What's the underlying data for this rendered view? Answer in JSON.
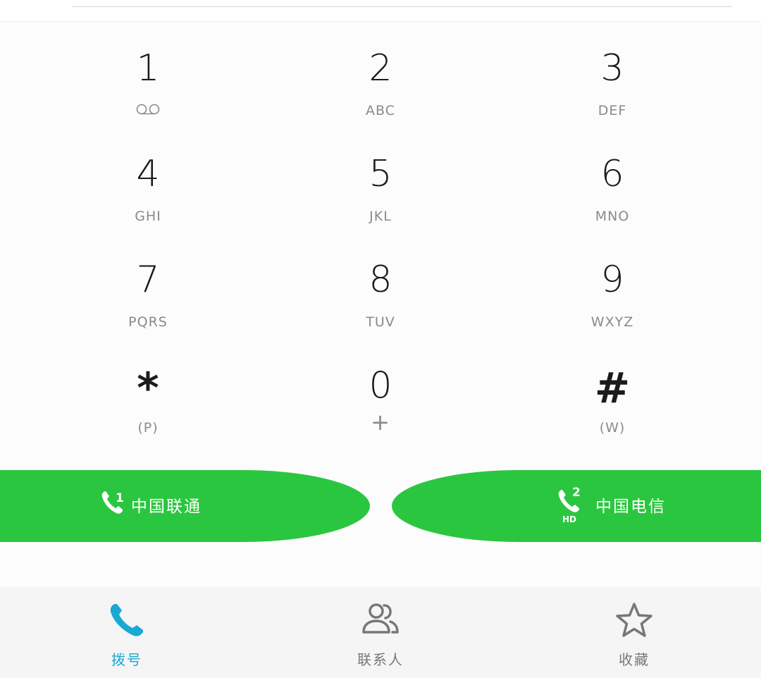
{
  "keypad": {
    "keys": [
      {
        "digit": "1",
        "letters": ""
      },
      {
        "digit": "2",
        "letters": "ABC"
      },
      {
        "digit": "3",
        "letters": "DEF"
      },
      {
        "digit": "4",
        "letters": "GHI"
      },
      {
        "digit": "5",
        "letters": "JKL"
      },
      {
        "digit": "6",
        "letters": "MNO"
      },
      {
        "digit": "7",
        "letters": "PQRS"
      },
      {
        "digit": "8",
        "letters": "TUV"
      },
      {
        "digit": "9",
        "letters": "WXYZ"
      },
      {
        "digit": "*",
        "letters": "(P)"
      },
      {
        "digit": "0",
        "letters": "+"
      },
      {
        "digit": "#",
        "letters": "(W)"
      }
    ]
  },
  "call_buttons": {
    "sim1": {
      "carrier": "中国联通",
      "sim_number": "1"
    },
    "sim2": {
      "carrier": "中国电信",
      "sim_number": "2",
      "badge": "HD"
    }
  },
  "bottom_nav": {
    "dial": {
      "label": "拨号",
      "icon": "phone-icon"
    },
    "contacts": {
      "label": "联系人",
      "icon": "contacts-icon"
    },
    "favorites": {
      "label": "收藏",
      "icon": "star-icon"
    }
  },
  "colors": {
    "call_green": "#2bc63f",
    "active_blue": "#1aa8d4",
    "text_dark": "#1b1b1b",
    "text_gray": "#8a8a8a"
  }
}
